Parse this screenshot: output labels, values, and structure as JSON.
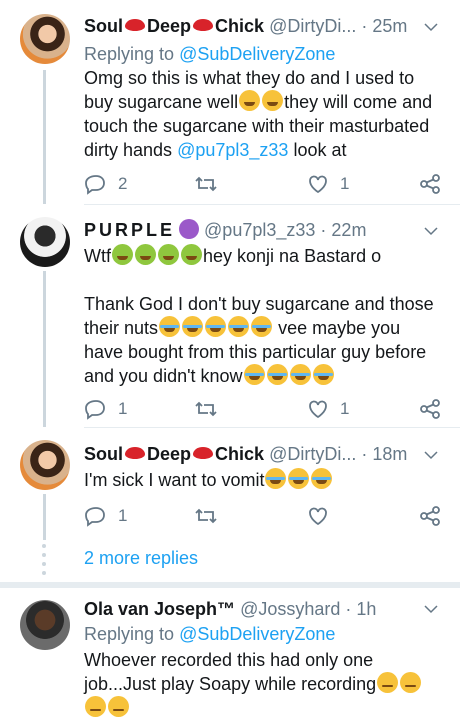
{
  "tweets": [
    {
      "name_a": "Soul",
      "name_b": "Deep",
      "name_c": "Chick",
      "handle": "@DirtyDi...",
      "time": "25m",
      "replying_label": "Replying to",
      "replying_to": "@SubDeliveryZone",
      "body_1": "Omg so this is what they do and I used to buy sugarcane well",
      "body_2": "they will come and touch the sugarcane with their masturbated dirty hands",
      "mention": "@pu7pl3_z33",
      "body_3": "look at",
      "replies": "2",
      "retweets": "",
      "likes": "1"
    },
    {
      "name": "PURPLE",
      "handle": "@pu7pl3_z33",
      "time": "22m",
      "line1_a": "Wtf",
      "line1_b": "hey konji na Bastard o",
      "line2_a": "Thank God I don't buy sugarcane and those their nuts",
      "line2_b": "vee maybe you have bought from this particular guy before and you didn't know",
      "replies": "1",
      "likes": "1"
    },
    {
      "name_a": "Soul",
      "name_b": "Deep",
      "name_c": "Chick",
      "handle": "@DirtyDi...",
      "time": "18m",
      "body": "I'm sick I want to vomit",
      "replies": "1"
    },
    {
      "name": "Ola van Joseph™",
      "handle": "@Jossyhard",
      "time": "1h",
      "replying_label": "Replying to",
      "replying_to": "@SubDeliveryZone",
      "body": "Whoever recorded this had only one job...Just play Soapy while recording"
    }
  ],
  "more_replies": "2 more replies",
  "colors": {
    "link": "#1da1f2",
    "muted": "#657786",
    "text": "#14171a",
    "divider": "#e6ecf0"
  }
}
